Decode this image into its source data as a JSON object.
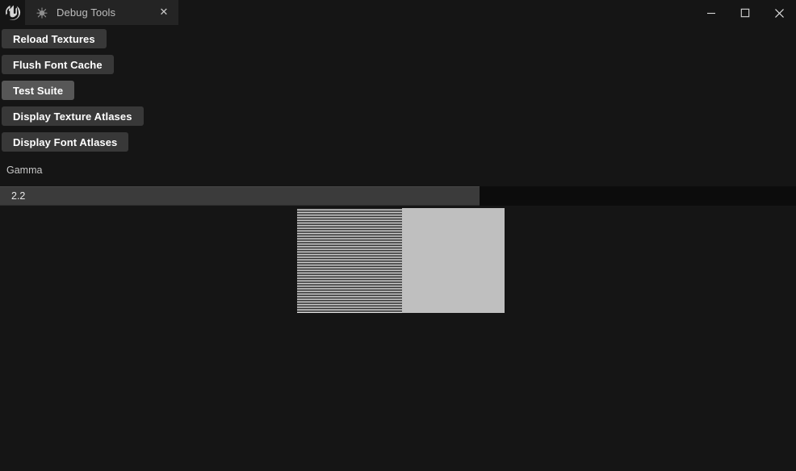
{
  "window": {
    "app_logo_icon": "unreal-engine-logo-icon",
    "tab": {
      "icon": "bug-debug-icon",
      "label": "Debug Tools",
      "close_label": "✕"
    },
    "controls": {
      "minimize_icon": "minimize-icon",
      "maximize_icon": "maximize-icon",
      "close_icon": "close-icon"
    }
  },
  "toolbar": {
    "buttons": [
      {
        "label": "Reload Textures",
        "name": "reload-textures-button",
        "state": "normal"
      },
      {
        "label": "Flush Font Cache",
        "name": "flush-font-cache-button",
        "state": "normal"
      },
      {
        "label": "Test Suite",
        "name": "test-suite-button",
        "state": "hovered"
      },
      {
        "label": "Display Texture Atlases",
        "name": "display-texture-atlases-button",
        "state": "normal"
      },
      {
        "label": "Display Font Atlases",
        "name": "display-font-atlases-button",
        "state": "normal"
      }
    ]
  },
  "gamma": {
    "label": "Gamma",
    "value": "2.2",
    "fill_percent": 60.2
  },
  "test_pattern": {
    "name": "gamma-calibration-pattern",
    "stripe_colors": [
      "#000000",
      "#ffffff"
    ],
    "solid_color": "#bfbfbf"
  },
  "colors": {
    "window_background": "#151515",
    "tab_background": "#242424",
    "button_background": "#383838",
    "button_hover_background": "#575757",
    "slider_track": "#0c0c0c",
    "slider_fill": "#3b3b3b",
    "text_primary": "#ffffff",
    "text_secondary": "#c8c8c8"
  }
}
